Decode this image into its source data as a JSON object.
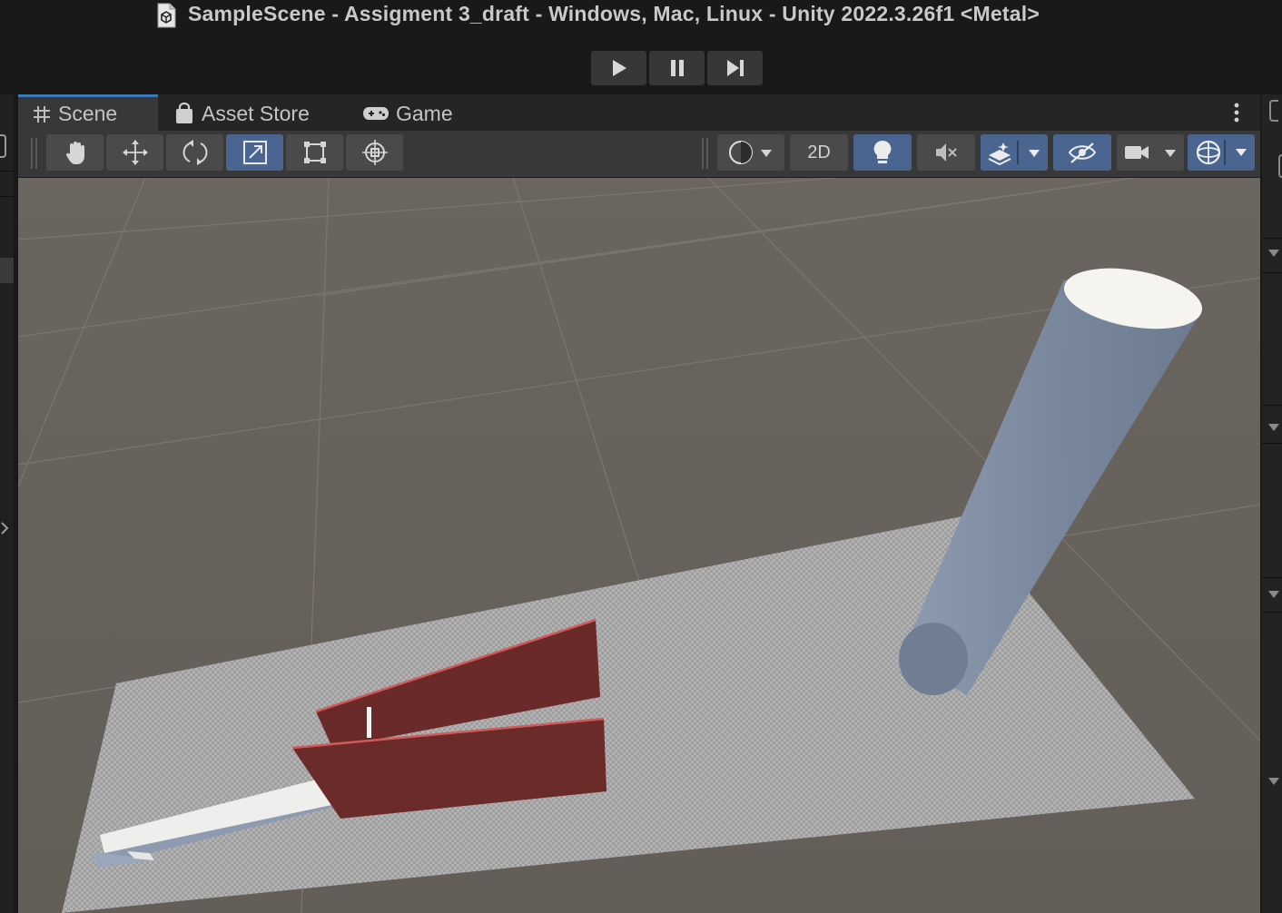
{
  "window": {
    "title": "SampleScene - Assigment 3_draft - Windows, Mac, Linux - Unity 2022.3.26f1 <Metal>"
  },
  "playbar": {
    "buttons": [
      "play-icon",
      "pause-icon",
      "step-icon"
    ]
  },
  "tabs": [
    {
      "label": "Scene",
      "icon": "grid-icon",
      "active": true
    },
    {
      "label": "Asset Store",
      "icon": "shopping-bag-icon",
      "active": false
    },
    {
      "label": "Game",
      "icon": "gamepad-icon",
      "active": false
    }
  ],
  "toolbar": {
    "tools": [
      "hand-tool-icon",
      "move-tool-icon",
      "rotate-tool-icon",
      "scale-tool-icon",
      "rect-tool-icon",
      "transform-tool-icon"
    ],
    "selected_tool": "scale-tool-icon",
    "mode_2d_label": "2D",
    "lighting_enabled": true,
    "audio_muted": true
  },
  "colors": {
    "accent": "#4a6590",
    "tab_highlight": "#3a79bb",
    "sky": "#6a645f",
    "red_object": "#6e2b2b",
    "cylinder": "#7f8c9f"
  }
}
